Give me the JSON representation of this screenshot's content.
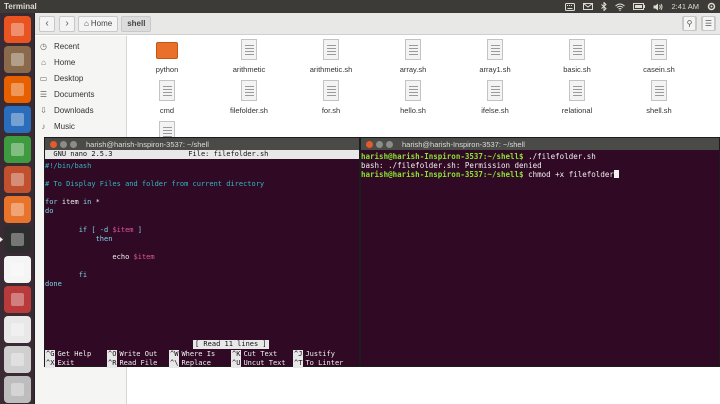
{
  "topbar": {
    "app_title": "Terminal",
    "clock": "2:41 AM"
  },
  "launcher": {
    "items": [
      {
        "icon": "ubuntu-logo-icon",
        "color": "#e95420"
      },
      {
        "icon": "files-icon",
        "color": "#8a6a4a"
      },
      {
        "icon": "firefox-icon",
        "color": "#e66000"
      },
      {
        "icon": "writer-icon",
        "color": "#2a6ebb"
      },
      {
        "icon": "calc-icon",
        "color": "#3f9b3f"
      },
      {
        "icon": "impress-icon",
        "color": "#c1502e"
      },
      {
        "icon": "software-center-icon",
        "color": "#e8742b"
      },
      {
        "icon": "terminal-icon",
        "color": "#2d2d2d"
      },
      {
        "icon": "amazon-icon",
        "color": "#f5f5f5"
      },
      {
        "icon": "settings-icon",
        "color": "#b93a3a"
      },
      {
        "icon": "text-editor-icon",
        "color": "#e8e8e8"
      },
      {
        "icon": "drive-icon",
        "color": "#cfcfcf"
      },
      {
        "icon": "trash-icon",
        "color": "#bdbdbd"
      }
    ]
  },
  "files": {
    "breadcrumb_home": "Home",
    "breadcrumb_current": "shell",
    "places": [
      {
        "icon": "clock-icon",
        "label": "Recent"
      },
      {
        "icon": "home-icon",
        "label": "Home"
      },
      {
        "icon": "desktop-icon",
        "label": "Desktop"
      },
      {
        "icon": "documents-icon",
        "label": "Documents"
      },
      {
        "icon": "downloads-icon",
        "label": "Downloads"
      },
      {
        "icon": "music-icon",
        "label": "Music"
      }
    ],
    "items": [
      {
        "name": "python",
        "kind": "folder"
      },
      {
        "name": "arithmetic",
        "kind": "file"
      },
      {
        "name": "arithmetic.sh",
        "kind": "file"
      },
      {
        "name": "array.sh",
        "kind": "file"
      },
      {
        "name": "array1.sh",
        "kind": "file"
      },
      {
        "name": "basic.sh",
        "kind": "file"
      },
      {
        "name": "casein.sh",
        "kind": "file"
      },
      {
        "name": "cmd",
        "kind": "file"
      },
      {
        "name": "filefolder.sh",
        "kind": "file"
      },
      {
        "name": "for.sh",
        "kind": "file"
      },
      {
        "name": "hello.sh",
        "kind": "file"
      },
      {
        "name": "ifelse.sh",
        "kind": "file"
      },
      {
        "name": "relational",
        "kind": "file"
      },
      {
        "name": "shell.sh",
        "kind": "file"
      },
      {
        "name": "",
        "kind": "file"
      }
    ]
  },
  "nano": {
    "window_title": "harish@harish-Inspiron-3537: ~/shell",
    "version": "  GNU nano 2.5.3",
    "file_label": "File: filefolder.sh",
    "lines": {
      "shebang": "#!/bin/bash",
      "comment": "# To Display Files and folder from current directory",
      "for_kw": "for",
      "for_rest": " item ",
      "in_kw": "in",
      "for_tail": " *",
      "do": "do",
      "if_kw": "        if",
      "if_mid": " [ -d ",
      "if_var": "$item",
      "if_end": " ]",
      "then": "            then",
      "echo_kw": "                echo ",
      "echo_var": "$item",
      "fi": "        fi",
      "done": "done"
    },
    "status": "[ Read 11 lines ]",
    "help": [
      [
        {
          "key": "^G",
          "label": "Get Help"
        },
        {
          "key": "^O",
          "label": "Write Out"
        },
        {
          "key": "^W",
          "label": "Where Is"
        },
        {
          "key": "^K",
          "label": "Cut Text"
        },
        {
          "key": "^J",
          "label": "Justify"
        }
      ],
      [
        {
          "key": "^X",
          "label": "Exit"
        },
        {
          "key": "^R",
          "label": "Read File"
        },
        {
          "key": "^\\",
          "label": "Replace"
        },
        {
          "key": "^U",
          "label": "Uncut Text"
        },
        {
          "key": "^T",
          "label": "To Linter"
        }
      ]
    ]
  },
  "terminal": {
    "window_title": "harish@harish-Inspiron-3537: ~/shell",
    "prompt": "harish@harish-Inspiron-3537:~/shell$",
    "cmd1": " ./filefolder.sh",
    "error": "bash: ./filefolder.sh: Permission denied",
    "cmd2": " chmod +x filefolder"
  }
}
